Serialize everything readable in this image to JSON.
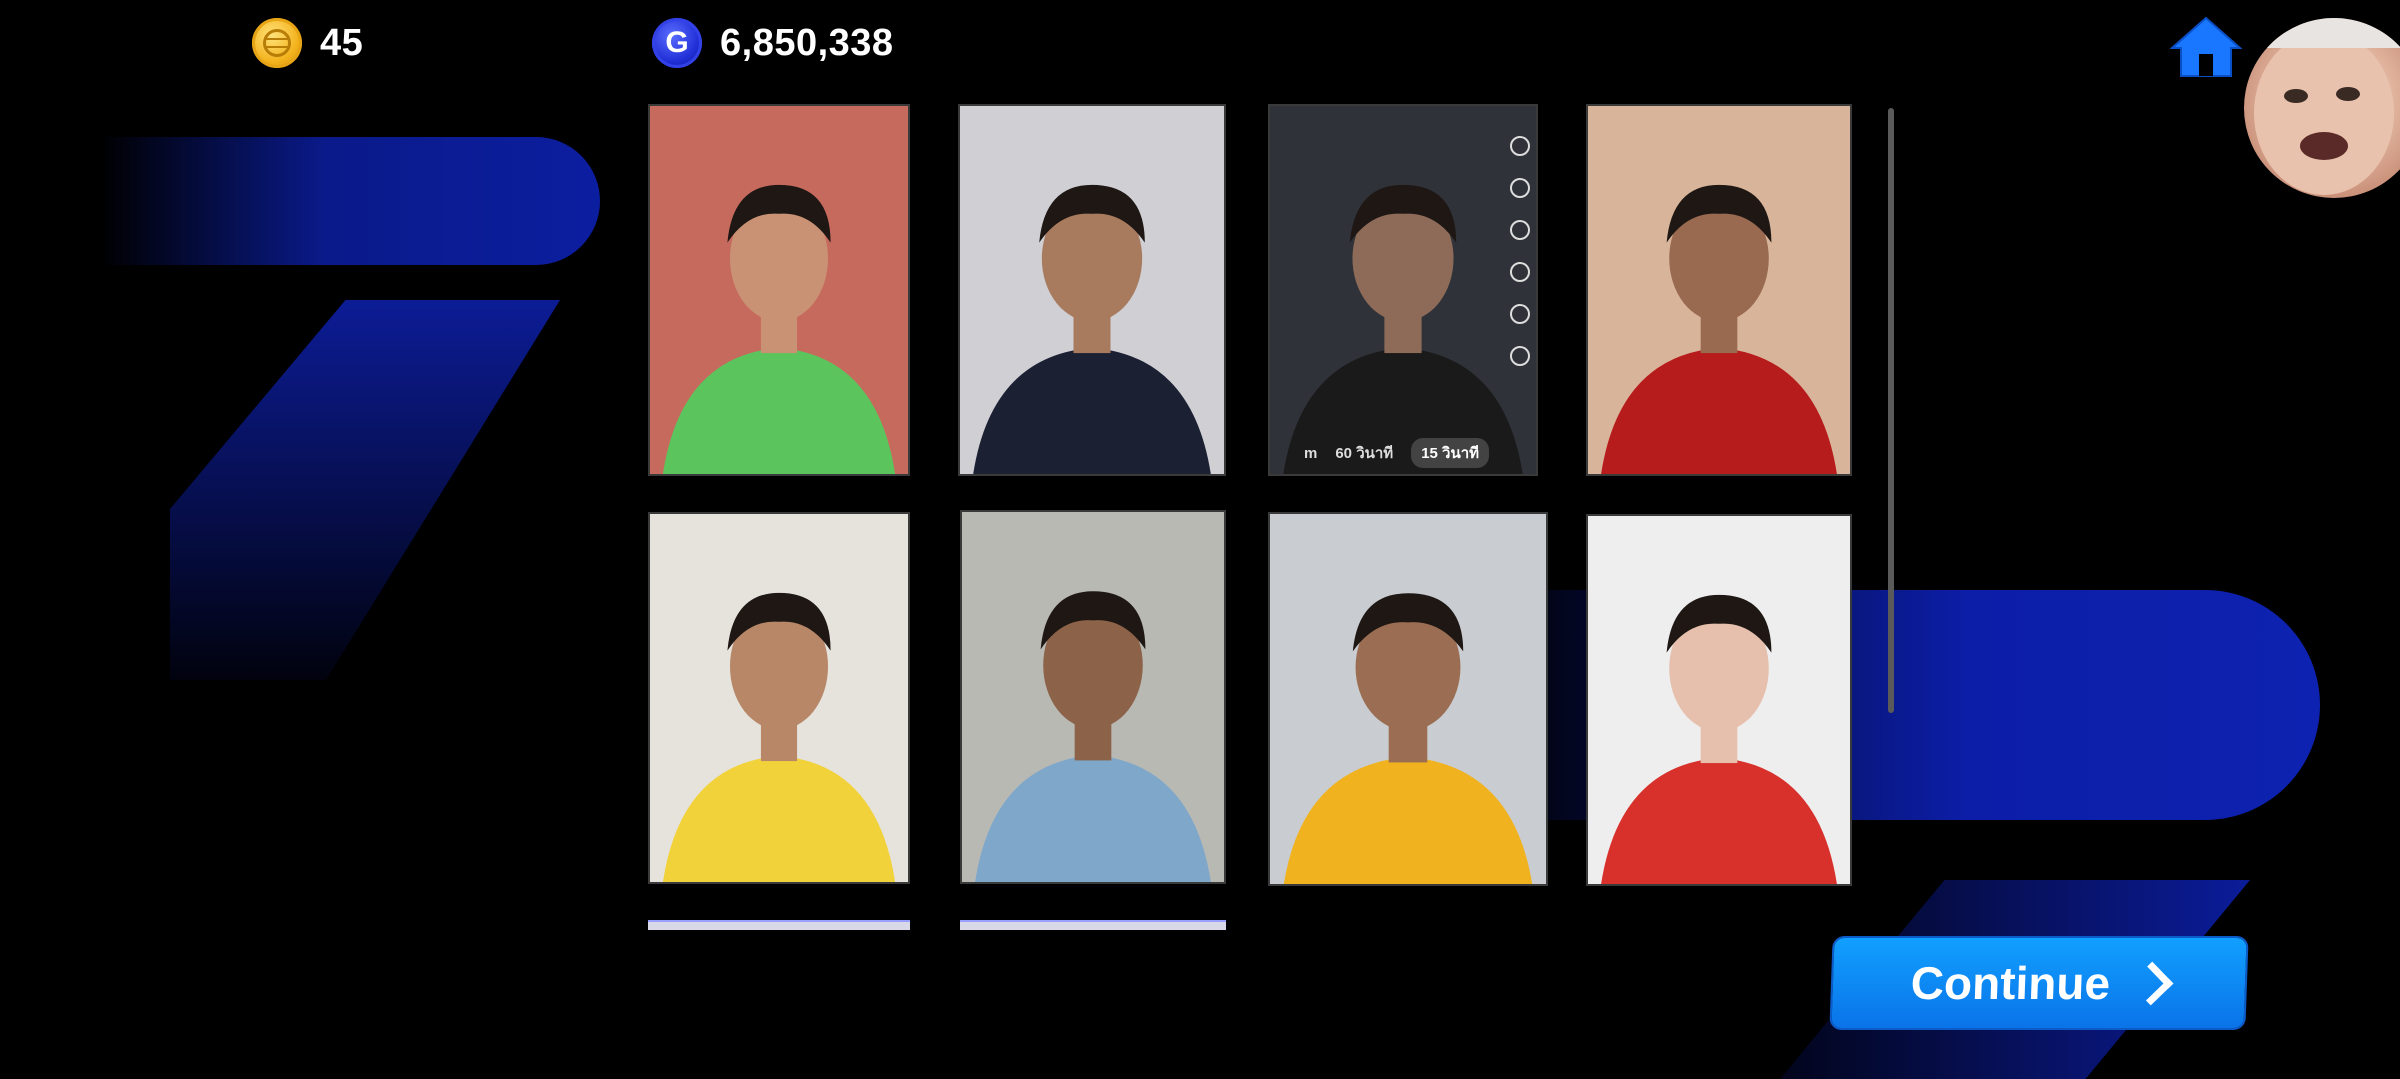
{
  "header": {
    "coins": {
      "icon": "coin-icon",
      "value": "45"
    },
    "gems": {
      "icon": "gem-icon",
      "value": "6,850,338"
    },
    "home_icon": "home-icon",
    "avatar_icon": "avatar"
  },
  "photo_grid": {
    "photos": [
      {
        "name": "photo-1",
        "bg": "#c76a5e",
        "shirt": "#5cc45c",
        "skin": "#c99275"
      },
      {
        "name": "photo-2",
        "bg": "#cfcfd4",
        "shirt": "#1c2033",
        "skin": "#a87a5e"
      },
      {
        "name": "photo-3",
        "bg": "#2f3238",
        "shirt": "#1a1a1a",
        "skin": "#8d6b58",
        "overlay_labels": [
          "m",
          "60 วินาที",
          "15 วินาที"
        ]
      },
      {
        "name": "photo-4",
        "bg": "#d8b59a",
        "shirt": "#b71c1c",
        "skin": "#9a6a50"
      },
      {
        "name": "photo-5",
        "bg": "#e6e2dc",
        "shirt": "#f2d23b",
        "skin": "#b78768"
      },
      {
        "name": "photo-6",
        "bg": "#b9b9b4",
        "shirt": "#7fa7c9",
        "skin": "#8c6248"
      },
      {
        "name": "photo-7",
        "bg": "#c9ccd0",
        "shirt": "#f0b21e",
        "skin": "#9b6d52"
      },
      {
        "name": "photo-8",
        "bg": "#eeeeee",
        "shirt": "#d8302b",
        "skin": "#e6c0ad"
      }
    ]
  },
  "continue_button": {
    "label": "Continue",
    "icon": "chevron-right-icon"
  },
  "colors": {
    "background": "#000000",
    "accent_blue": "#0a73e8",
    "decor_blue": "#0c1ea0"
  }
}
